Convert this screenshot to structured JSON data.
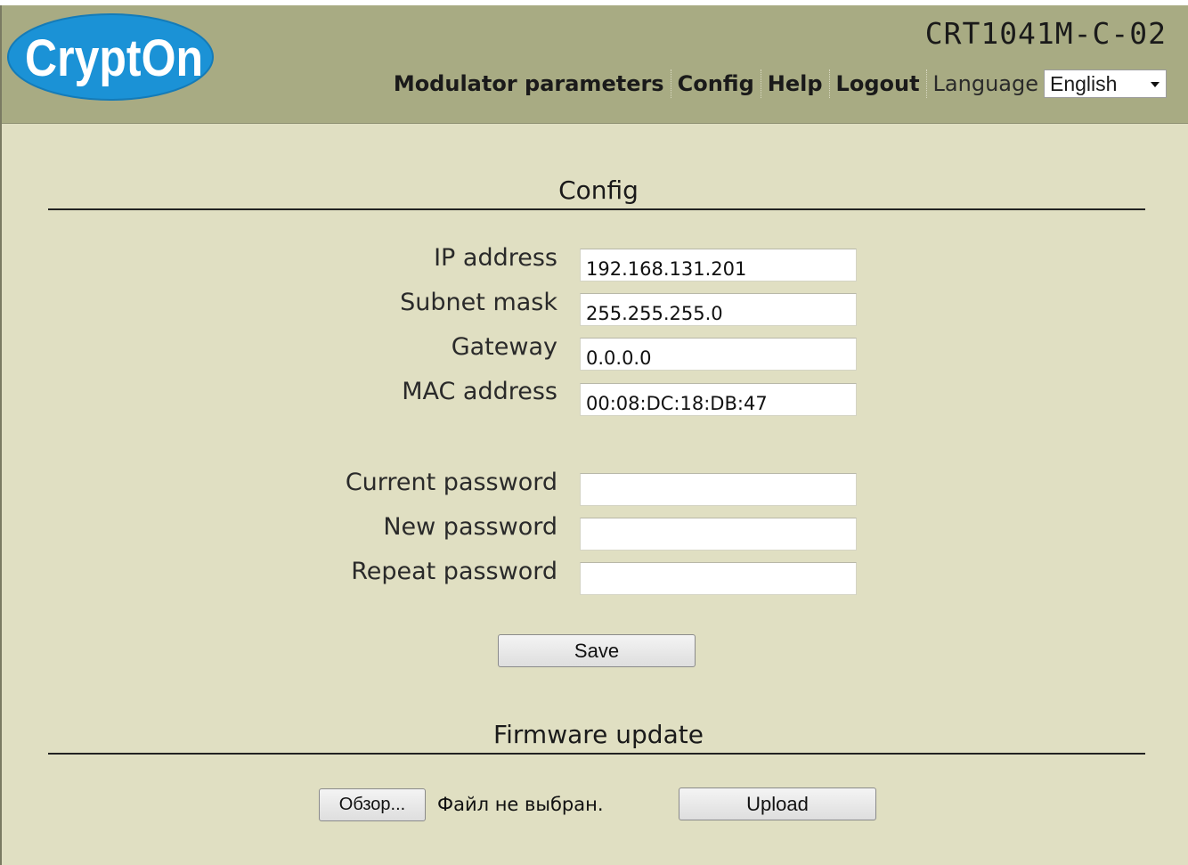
{
  "header": {
    "logo_text": "CryptOn",
    "device_title": "CRT1041M-C-02",
    "nav": {
      "modulator": "Modulator parameters",
      "config": "Config",
      "help": "Help",
      "logout": "Logout"
    },
    "language_label": "Language",
    "language_selected": "English"
  },
  "config": {
    "title": "Config",
    "ip_label": "IP address",
    "ip_value": "192.168.131.201",
    "subnet_label": "Subnet mask",
    "subnet_value": "255.255.255.0",
    "gateway_label": "Gateway",
    "gateway_value": "0.0.0.0",
    "mac_label": "MAC address",
    "mac_value": "00:08:DC:18:DB:47",
    "current_password_label": "Current password",
    "new_password_label": "New password",
    "repeat_password_label": "Repeat password",
    "save_label": "Save"
  },
  "firmware": {
    "title": "Firmware update",
    "browse_label": "Обзор...",
    "file_status": "Файл не выбран.",
    "upload_label": "Upload"
  },
  "colors": {
    "header_bg": "#a8ab83",
    "page_bg": "#e0dfc2",
    "logo_blue": "#1b92d6"
  }
}
